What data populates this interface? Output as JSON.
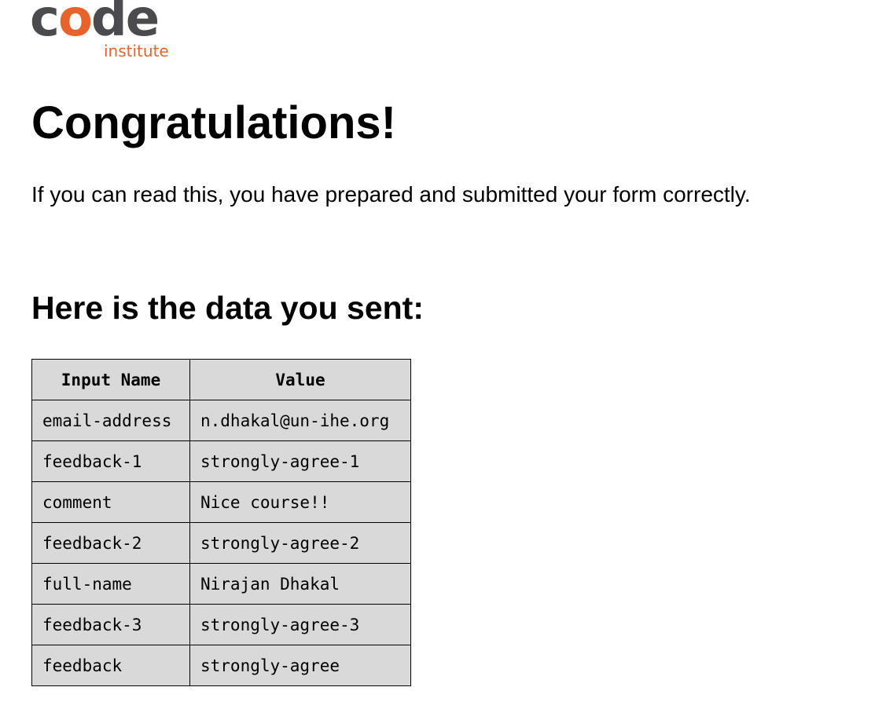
{
  "logo": {
    "code_prefix": "c",
    "code_o": "o",
    "code_suffix": "de",
    "institute": "institute"
  },
  "title": "Congratulations!",
  "message": "If you can read this, you have prepared and submitted your form correctly.",
  "subtitle": "Here is the data you sent:",
  "table": {
    "headers": [
      "Input Name",
      "Value"
    ],
    "rows": [
      {
        "name": "email-address",
        "value": "n.dhakal@un-ihe.org"
      },
      {
        "name": "feedback-1",
        "value": "strongly-agree-1"
      },
      {
        "name": "comment",
        "value": "Nice course!!"
      },
      {
        "name": "feedback-2",
        "value": "strongly-agree-2"
      },
      {
        "name": "full-name",
        "value": "Nirajan Dhakal"
      },
      {
        "name": "feedback-3",
        "value": "strongly-agree-3"
      },
      {
        "name": "feedback",
        "value": "strongly-agree"
      }
    ]
  },
  "colors": {
    "logo_dark": "#4a4a4f",
    "logo_accent": "#e8632c",
    "table_bg": "#d9d9d9"
  }
}
